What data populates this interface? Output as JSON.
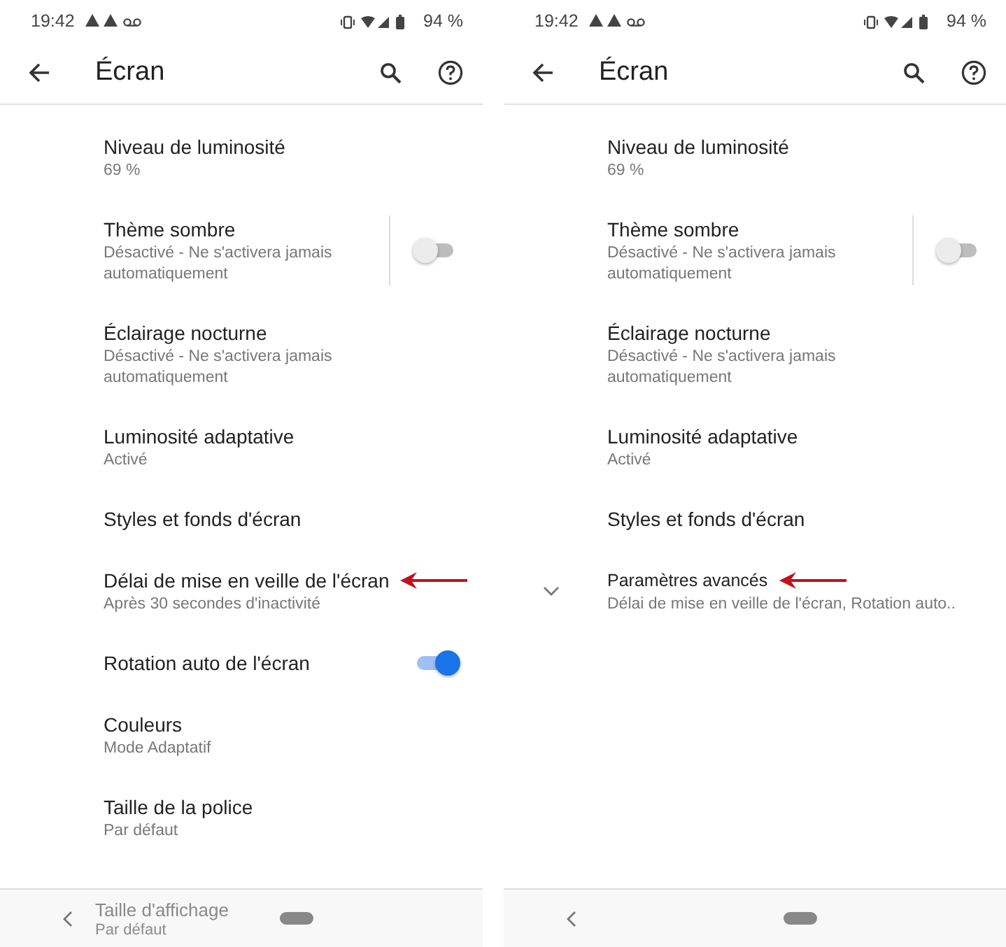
{
  "screens": [
    {
      "status_bar": {
        "time": "19:42",
        "battery": "94 %"
      },
      "toolbar": {
        "title": "Écran"
      },
      "items": [
        {
          "kind": "text",
          "title": "Niveau de luminosité",
          "summary": "69 %",
          "annotated": false
        },
        {
          "kind": "switch",
          "title": "Thème sombre",
          "summary": "Désactivé - Ne s'activera jamais automatiquement",
          "on": false,
          "separated": true,
          "annotated": false
        },
        {
          "kind": "text",
          "title": "Éclairage nocturne",
          "summary": "Désactivé - Ne s'activera jamais automatiquement",
          "annotated": false
        },
        {
          "kind": "text",
          "title": "Luminosité adaptative",
          "summary": "Activé",
          "annotated": false
        },
        {
          "kind": "text",
          "title": "Styles et fonds d'écran",
          "annotated": false
        },
        {
          "kind": "text",
          "title": "Délai de mise en veille de l'écran",
          "summary": "Après 30 secondes d'inactivité",
          "annotated": true
        },
        {
          "kind": "switch",
          "title": "Rotation auto de l'écran",
          "on": true,
          "separated": false,
          "annotated": false
        },
        {
          "kind": "text",
          "title": "Couleurs",
          "summary": "Mode Adaptatif",
          "annotated": false
        },
        {
          "kind": "text",
          "title": "Taille de la police",
          "summary": "Par défaut",
          "annotated": false
        }
      ],
      "peek": {
        "title": "Taille d'affichage",
        "summary": "Par défaut"
      }
    },
    {
      "status_bar": {
        "time": "19:42",
        "battery": "94 %"
      },
      "toolbar": {
        "title": "Écran"
      },
      "items": [
        {
          "kind": "text",
          "title": "Niveau de luminosité",
          "summary": "69 %",
          "annotated": false
        },
        {
          "kind": "switch",
          "title": "Thème sombre",
          "summary": "Désactivé - Ne s'activera jamais automatiquement",
          "on": false,
          "separated": true,
          "annotated": false
        },
        {
          "kind": "text",
          "title": "Éclairage nocturne",
          "summary": "Désactivé - Ne s'activera jamais automatiquement",
          "annotated": false
        },
        {
          "kind": "text",
          "title": "Luminosité adaptative",
          "summary": "Activé",
          "annotated": false
        },
        {
          "kind": "text",
          "title": "Styles et fonds d'écran",
          "annotated": false
        },
        {
          "kind": "expand",
          "title": "Paramètres avancés",
          "summary": "Délai de mise en veille de l'écran, Rotation auto..",
          "annotated": true
        }
      ]
    }
  ]
}
